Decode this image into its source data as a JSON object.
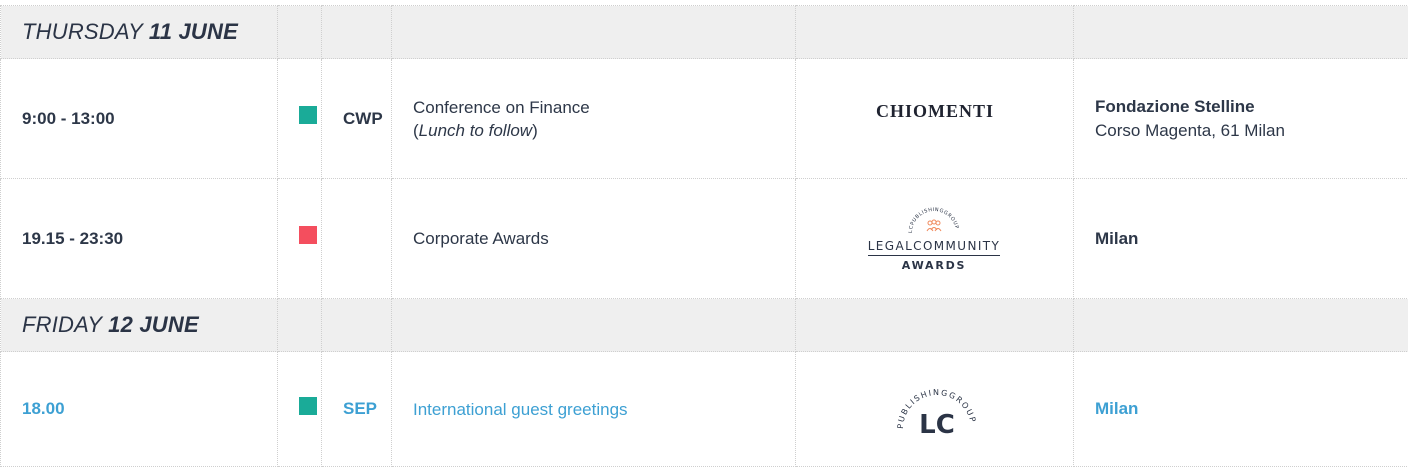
{
  "days": [
    {
      "day_name": "THURSDAY",
      "day_date": "11 JUNE",
      "events": [
        {
          "time": "9:00 - 13:00",
          "color": "#1aab98",
          "tag": "CWP",
          "title_line1": "Conference on Finance",
          "title_line2_prefix": "(",
          "title_line2_italic": "Lunch to follow",
          "title_line2_suffix": ")",
          "logo_text": "CHIOMENTI",
          "venue_name": "Fondazione Stelline",
          "venue_address": "Corso Magenta, 61 Milan"
        },
        {
          "time": "19.15 - 23:30",
          "color": "#f44e5e",
          "tag": "",
          "title_line1": "Corporate Awards",
          "logo_arc_text": "LCPUBLISHINGGROUP",
          "logo_name": "LEGALCOMMUNITY",
          "logo_sub": "AWARDS",
          "venue_name": "Milan"
        }
      ]
    },
    {
      "day_name": "FRIDAY",
      "day_date": "12 JUNE",
      "events": [
        {
          "time": "18.00",
          "color": "#1aab98",
          "tag": "SEP",
          "title_line1": "International guest greetings",
          "logo_arc_text": "PUBLISHINGGROUP",
          "logo_mark": "LC",
          "venue_name": "Milan"
        }
      ]
    }
  ]
}
